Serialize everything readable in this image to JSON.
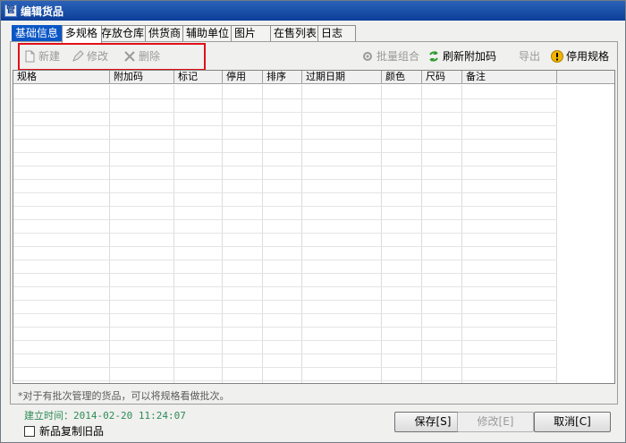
{
  "window": {
    "title": "编辑货品",
    "app_icon": "管"
  },
  "tabs": [
    {
      "label": "基础信息"
    },
    {
      "label": "多规格"
    },
    {
      "label": "存放仓库"
    },
    {
      "label": "供货商"
    },
    {
      "label": "辅助单位"
    },
    {
      "label": "图片"
    },
    {
      "label": "在售列表"
    },
    {
      "label": "日志"
    }
  ],
  "toolbar": {
    "new_label": "新建",
    "edit_label": "修改",
    "delete_label": "删除",
    "batch_label": "批量组合",
    "refresh_label": "刷新附加码",
    "export_label": "导出",
    "disable_label": "停用规格"
  },
  "grid": {
    "columns": [
      "规格",
      "附加码",
      "标记",
      "停用",
      "排序",
      "过期日期",
      "颜色",
      "尺码",
      "备注"
    ]
  },
  "hint": "*对于有批次管理的货品，可以将规格看做批次。",
  "footer": {
    "created": "建立时间：2014-02-20 11:24:07",
    "copy_checkbox_label": "新品复制旧品",
    "save_label": "保存[S]",
    "edit_label": "修改[E]",
    "cancel_label": "取消[C]"
  },
  "colors": {
    "highlight": "#e0101a",
    "created_text": "#2e8b57",
    "title_bar": "#0b3e99"
  }
}
